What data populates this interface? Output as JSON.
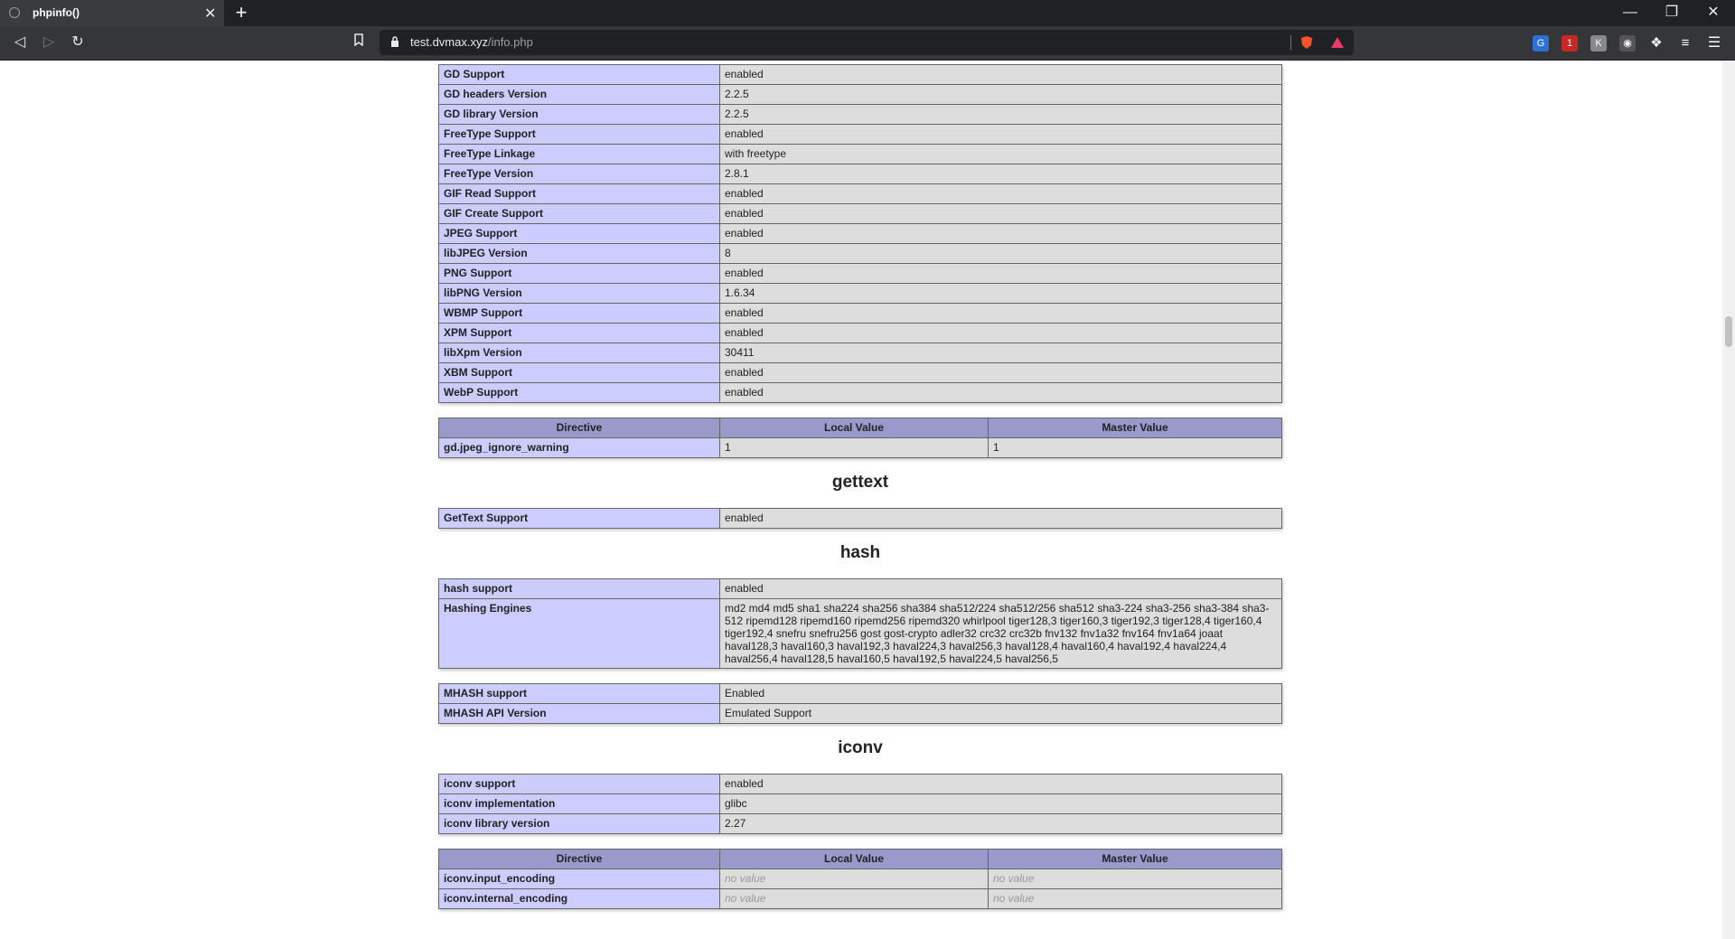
{
  "browser": {
    "tab_title": "phpinfo()",
    "url_host": "test.dvmax.xyz",
    "url_path": "/info.php",
    "new_tab": "+",
    "close_tab": "✕"
  },
  "gd_table": [
    {
      "k": "GD Support",
      "v": "enabled"
    },
    {
      "k": "GD headers Version",
      "v": "2.2.5"
    },
    {
      "k": "GD library Version",
      "v": "2.2.5"
    },
    {
      "k": "FreeType Support",
      "v": "enabled"
    },
    {
      "k": "FreeType Linkage",
      "v": "with freetype"
    },
    {
      "k": "FreeType Version",
      "v": "2.8.1"
    },
    {
      "k": "GIF Read Support",
      "v": "enabled"
    },
    {
      "k": "GIF Create Support",
      "v": "enabled"
    },
    {
      "k": "JPEG Support",
      "v": "enabled"
    },
    {
      "k": "libJPEG Version",
      "v": "8"
    },
    {
      "k": "PNG Support",
      "v": "enabled"
    },
    {
      "k": "libPNG Version",
      "v": "1.6.34"
    },
    {
      "k": "WBMP Support",
      "v": "enabled"
    },
    {
      "k": "XPM Support",
      "v": "enabled"
    },
    {
      "k": "libXpm Version",
      "v": "30411"
    },
    {
      "k": "XBM Support",
      "v": "enabled"
    },
    {
      "k": "WebP Support",
      "v": "enabled"
    }
  ],
  "headers": {
    "directive": "Directive",
    "local": "Local Value",
    "master": "Master Value"
  },
  "gd_directives": [
    {
      "k": "gd.jpeg_ignore_warning",
      "local": "1",
      "master": "1"
    }
  ],
  "gettext": {
    "title": "gettext",
    "rows": [
      {
        "k": "GetText Support",
        "v": "enabled"
      }
    ]
  },
  "hash": {
    "title": "hash",
    "rows": [
      {
        "k": "hash support",
        "v": "enabled"
      },
      {
        "k": "Hashing Engines",
        "v": "md2 md4 md5 sha1 sha224 sha256 sha384 sha512/224 sha512/256 sha512 sha3-224 sha3-256 sha3-384 sha3-512 ripemd128 ripemd160 ripemd256 ripemd320 whirlpool tiger128,3 tiger160,3 tiger192,3 tiger128,4 tiger160,4 tiger192,4 snefru snefru256 gost gost-crypto adler32 crc32 crc32b fnv132 fnv1a32 fnv164 fnv1a64 joaat haval128,3 haval160,3 haval192,3 haval224,3 haval256,3 haval128,4 haval160,4 haval192,4 haval224,4 haval256,4 haval128,5 haval160,5 haval192,5 haval224,5 haval256,5"
      }
    ],
    "mhash_rows": [
      {
        "k": "MHASH support",
        "v": "Enabled"
      },
      {
        "k": "MHASH API Version",
        "v": "Emulated Support"
      }
    ]
  },
  "iconv": {
    "title": "iconv",
    "rows": [
      {
        "k": "iconv support",
        "v": "enabled"
      },
      {
        "k": "iconv implementation",
        "v": "glibc"
      },
      {
        "k": "iconv library version",
        "v": "2.27"
      }
    ],
    "directives": [
      {
        "k": "iconv.input_encoding",
        "local": "no value",
        "master": "no value"
      },
      {
        "k": "iconv.internal_encoding",
        "local": "no value",
        "master": "no value"
      }
    ]
  },
  "colors": {
    "key_bg": "#ccccff",
    "value_bg": "#dddddd",
    "header_bg": "#9999cc"
  }
}
